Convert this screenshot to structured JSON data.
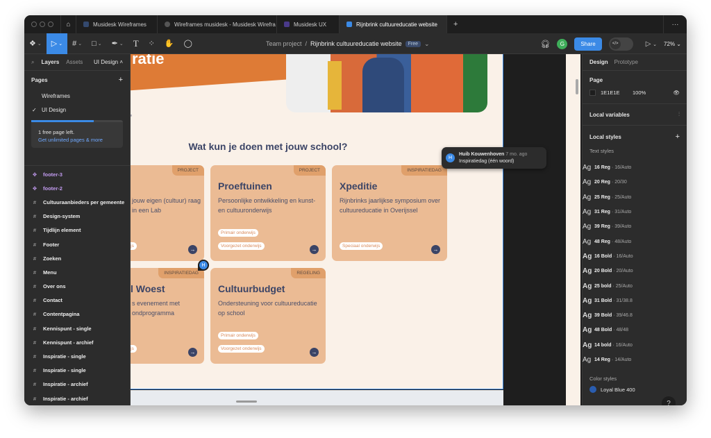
{
  "tabs": [
    {
      "label": "Musidesk Wireframes"
    },
    {
      "label": "Wireframes musidesk - Musidesk Wirefra"
    },
    {
      "label": "Musidesk UX"
    },
    {
      "label": "Rijnbrink cultuureducatie website",
      "active": true
    }
  ],
  "toolbar": {
    "project": "Team project",
    "separator": "/",
    "file": "Rijnbrink cultuureducatie website",
    "plan_badge": "Free",
    "avatar": "G",
    "share": "Share",
    "zoom": "72%"
  },
  "left_panel": {
    "tabs": {
      "layers": "Layers",
      "assets": "Assets",
      "page": "UI Design"
    },
    "pages_title": "Pages",
    "pages": [
      {
        "label": "Wireframes"
      },
      {
        "label": "UI Design",
        "selected": true
      }
    ],
    "promo": {
      "text": "1 free page left.",
      "link": "Get unlimited pages & more",
      "progress": 0.67
    },
    "layers": [
      {
        "label": "footer-3",
        "type": "component"
      },
      {
        "label": "footer-2",
        "type": "component"
      },
      {
        "label": "Cultuuraanbieders per gemeente",
        "type": "frame"
      },
      {
        "label": "Design-system",
        "type": "frame"
      },
      {
        "label": "Tijdlijn element",
        "type": "frame"
      },
      {
        "label": "Footer",
        "type": "frame"
      },
      {
        "label": "Zoeken",
        "type": "frame"
      },
      {
        "label": "Menu",
        "type": "frame"
      },
      {
        "label": "Over ons",
        "type": "frame"
      },
      {
        "label": "Contact",
        "type": "frame"
      },
      {
        "label": "Contentpagina",
        "type": "frame"
      },
      {
        "label": "Kennispunt - single",
        "type": "frame"
      },
      {
        "label": "Kennispunt - archief",
        "type": "frame"
      },
      {
        "label": "Inspiratie - single",
        "type": "frame"
      },
      {
        "label": "Inspiratie - single",
        "type": "frame"
      },
      {
        "label": "Inspiratie - archief",
        "type": "frame"
      },
      {
        "label": "Inspiratie - archief",
        "type": "frame"
      }
    ]
  },
  "right_panel": {
    "tabs": {
      "design": "Design",
      "prototype": "Prototype"
    },
    "page_title": "Page",
    "page_color": "1E1E1E",
    "page_opacity": "100%",
    "local_variables": "Local variables",
    "local_styles": "Local styles",
    "text_styles_title": "Text styles",
    "text_styles": [
      {
        "ag": "Ag",
        "name": "16 Reg",
        "spec": " · 16/Auto"
      },
      {
        "ag": "Ag",
        "name": "20 Reg",
        "spec": " · 20/30"
      },
      {
        "ag": "Ag",
        "name": "25 Reg",
        "spec": " · 25/Auto"
      },
      {
        "ag": "Ag",
        "name": "31 Reg",
        "spec": " · 31/Auto"
      },
      {
        "ag": "Ag",
        "name": "39 Reg",
        "spec": " · 39/Auto"
      },
      {
        "ag": "Ag",
        "name": "48 Reg",
        "spec": " · 48/Auto"
      },
      {
        "ag": "Ag",
        "name": "16 Bold",
        "spec": " · 16/Auto",
        "bold": true
      },
      {
        "ag": "Ag",
        "name": "20 Bold",
        "spec": " · 20/Auto",
        "bold": true
      },
      {
        "ag": "Ag",
        "name": "25 bold",
        "spec": " · 25/Auto",
        "bold": true
      },
      {
        "ag": "Ag",
        "name": "31 Bold",
        "spec": " · 31/38.8",
        "bold": true
      },
      {
        "ag": "Ag",
        "name": "39 Bold",
        "spec": " · 39/46.8",
        "bold": true
      },
      {
        "ag": "Ag",
        "name": "48 Bold",
        "spec": " · 48/48",
        "bold": true
      },
      {
        "ag": "Ag",
        "name": "14 bold",
        "spec": " · 16/Auto",
        "bold": true
      },
      {
        "ag": "Ag",
        "name": "14 Reg",
        "spec": " · 14/Auto"
      }
    ],
    "color_styles_title": "Color styles",
    "color_styles": [
      {
        "name": "Loyal Blue 400",
        "color": "#2a5db0"
      }
    ],
    "help": "?"
  },
  "canvas": {
    "hero_text": "ratie",
    "small_text": "ie",
    "heading": "Wat kun je doen met jouw school?",
    "cards": [
      {
        "tag": "PROJECT",
        "title": "",
        "desc": "jouw eigen (cultuur) raag in een Lab",
        "pills": [
          "wijs"
        ]
      },
      {
        "tag": "PROJECT",
        "title": "Proeftuinen",
        "desc": "Persoonlijke ontwikkeling en kunst- en cultuuronderwijs",
        "pills": [
          "Primair onderwijs",
          "Voorgezet onderwijs"
        ]
      },
      {
        "tag": "INSPIRATIEDAG",
        "title": "Xpeditie",
        "desc": "Rijnbrinks jaarlijkse symposium over cultuureducatie in Overijssel",
        "pills": [
          "Speciaal onderwijs"
        ]
      },
      {
        "tag": "INSPIRATIEDAG",
        "title": "l Woest",
        "desc": "s evenement met ondprogramma",
        "pills": [
          "wijs"
        ]
      },
      {
        "tag": "REGELING",
        "title": "Cultuurbudget",
        "desc": "Ondersteuning voor cultuureducatie op school",
        "pills": [
          "Primair onderwijs",
          "Voorgezet onderwijs"
        ]
      }
    ],
    "comment": {
      "avatar": "H",
      "author": "Huib Kouwenhoven",
      "time": "7 mo. ago",
      "text": "Inspiratiedag (één woord)"
    },
    "marker": "H"
  },
  "colors": {
    "accent": "#3b8ae6",
    "card": "#ebbb94",
    "tag": "#e0a06b",
    "hero": "#de7b36",
    "navy": "#3b4466",
    "frame_bg": "#faf1e8"
  }
}
